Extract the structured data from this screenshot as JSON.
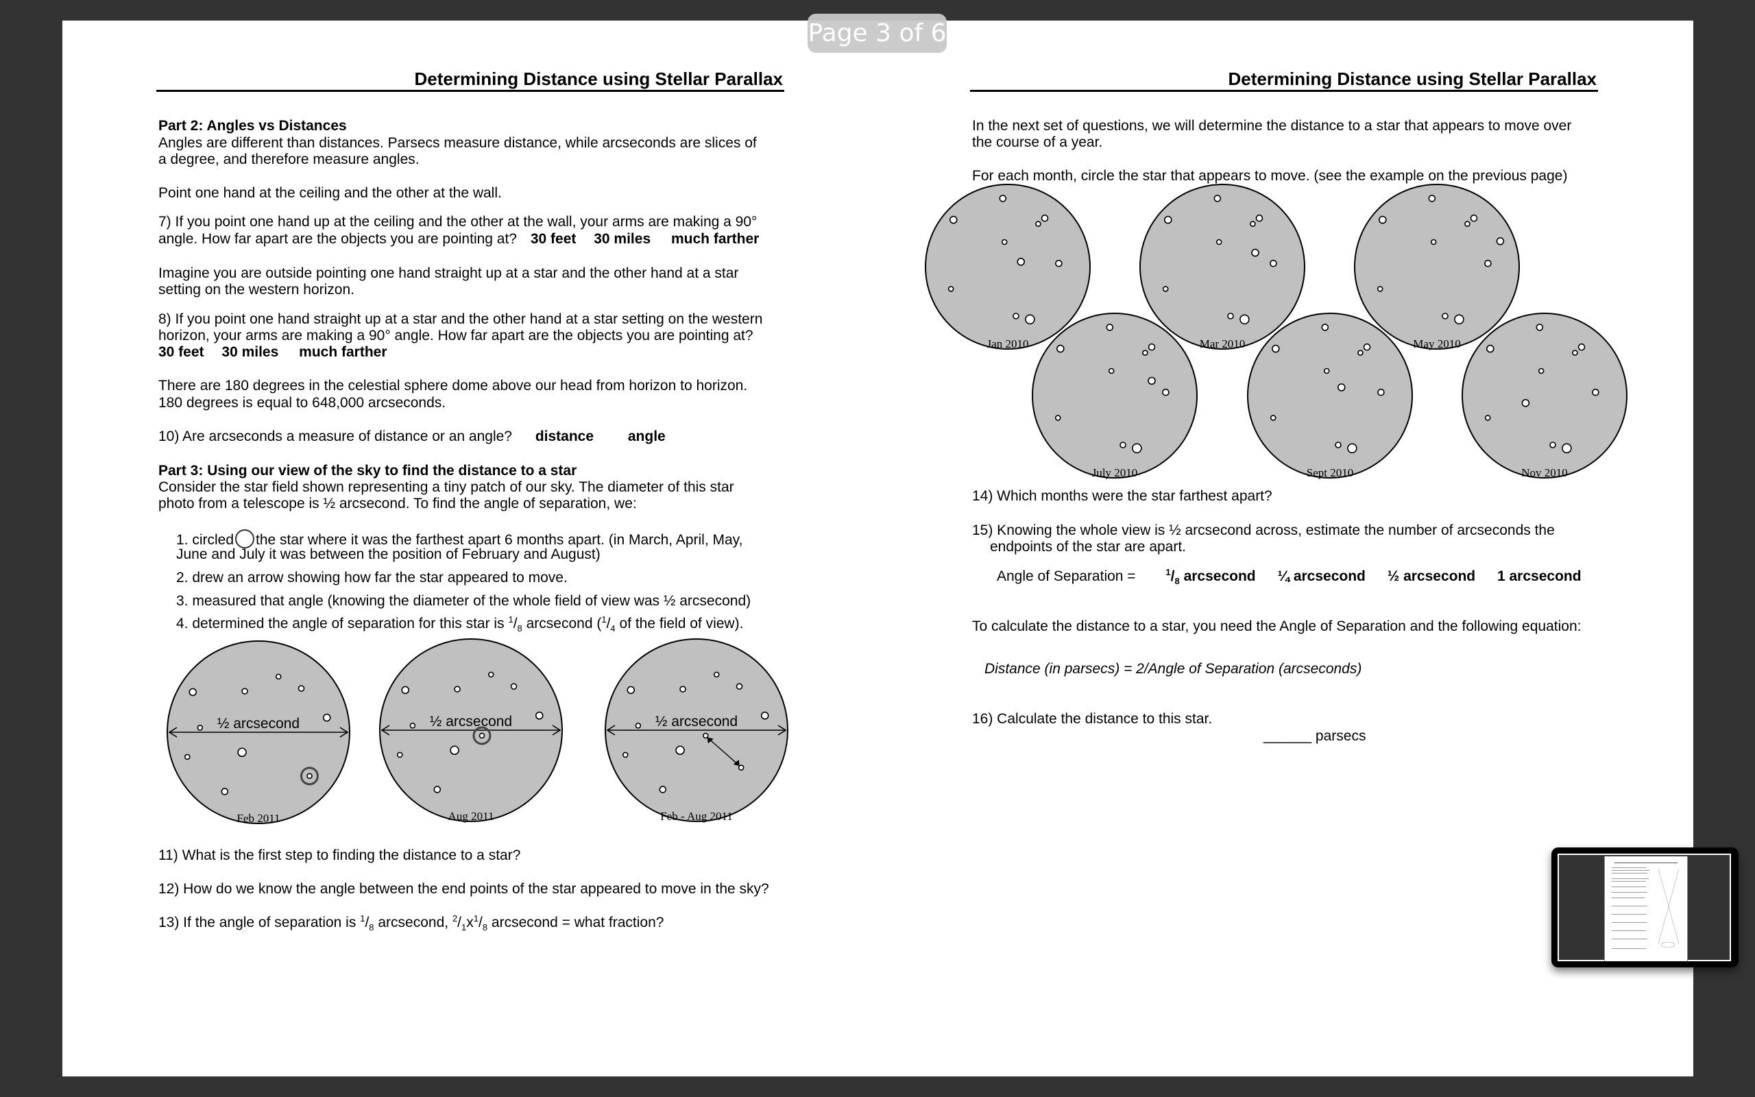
{
  "viewer": {
    "page_indicator": "Page 3 of 6"
  },
  "left_page": {
    "header": "Determining Distance using Stellar Parallax",
    "part2_title": "Part 2: Angles vs Distances",
    "part2_intro_line1": "Angles are different than distances.  Parsecs measure distance, while arcseconds are slices of",
    "part2_intro_line2": "a degree, and therefore measure angles.",
    "point_instruction": "Point one hand at the ceiling and the other at the wall.",
    "q7_line1": "7) If you point one hand up at the ceiling and the other at the wall, your arms are making a 90°",
    "q7_line2": "angle.  How far apart are the objects you are pointing at?",
    "q7_options": [
      "30 feet",
      "30 miles",
      "much farther"
    ],
    "imagine_line1": "Imagine you are outside pointing one hand straight up at a star and the other hand at a star",
    "imagine_line2": "setting on the western horizon.",
    "q8_line1": "8) If you point one hand straight up at a star and the other hand at a star setting on the western",
    "q8_line2": "horizon, your arms are making a 90° angle.  How far apart are the objects you are pointing at?",
    "q8_options": [
      "30 feet",
      "30 miles",
      "much farther"
    ],
    "degrees_line1": "There are 180 degrees in the celestial sphere dome above our head from horizon to horizon.",
    "degrees_line2": "180 degrees is equal to 648,000 arcseconds.",
    "q10_text": "10) Are arcseconds a measure of distance or an angle?",
    "q10_options": [
      "distance",
      "angle"
    ],
    "part3_title": "Part 3: Using our view of the sky to find the distance to a star",
    "part3_intro_line1": "Consider the star field shown representing a tiny patch of our sky.  The diameter of this star",
    "part3_intro_line2": "photo from a telescope is ½ arcsecond.  To find the angle of separation, we:",
    "step1_a": "1. circled",
    "step1_b": "the star where it was the farthest apart 6 months apart.  (in March, April, May,",
    "step1_c": "June and July it was between the position of February and August)",
    "step2": "2. drew an arrow showing how far the star appeared to move.",
    "step3": "3. measured that angle (knowing the diameter of the whole field of view was ½ arcsecond)",
    "step4_a": "4. determined the angle of separation for this star is",
    "step4_frac_num": "1",
    "step4_frac_den": "8",
    "step4_b": "arcsecond (",
    "step4_frac2_num": "1",
    "step4_frac2_den": "4",
    "step4_c": "of the field of view).",
    "example_fields": [
      {
        "label": "Feb 2011",
        "scale_label": "½ arcsecond"
      },
      {
        "label": "Aug 2011",
        "scale_label": "½ arcsecond"
      },
      {
        "label": "Feb - Aug 2011",
        "scale_label": "½ arcsecond"
      }
    ],
    "q11": "11) What is the first step to finding the distance to a star?",
    "q12": "12) How do we know the angle between the end points of the star appeared to move in the sky?",
    "q13_a": "13) If the angle of separation is",
    "q13_frac_num": "1",
    "q13_frac_den": "8",
    "q13_b": "arcsecond,",
    "q13_frac2_num": "2",
    "q13_frac2_den": "1",
    "q13_x": "x",
    "q13_frac3_num": "1",
    "q13_frac3_den": "8",
    "q13_c": "arcsecond = what fraction?"
  },
  "right_page": {
    "header": "Determining Distance using Stellar Parallax",
    "intro_line1": "In the next set of questions, we will determine the distance to a star that appears to move over",
    "intro_line2": "the course of a year.",
    "instruction": "For each month, circle the star that appears to move.  (see the example on the previous page)",
    "month_fields": [
      {
        "label": "Jan 2010"
      },
      {
        "label": "Mar 2010"
      },
      {
        "label": "May 2010"
      },
      {
        "label": "July 2010"
      },
      {
        "label": "Sept 2010"
      },
      {
        "label": "Nov 2010"
      }
    ],
    "q14": "14) Which months were the star farthest apart?",
    "q15_line1": "15) Knowing the whole view is ½ arcsecond across, estimate the number of arcseconds the",
    "q15_line2": "endpoints of the star are apart.",
    "angle_label": "Angle of Separation =",
    "angle_opt1_num": "1",
    "angle_opt1_den": "8",
    "angle_opt1_unit": "arcsecond",
    "angle_options": [
      "¼ arcsecond",
      "½ arcsecond",
      "1 arcsecond"
    ],
    "calc_intro": "To calculate the distance to a star, you need the Angle of Separation and the following equation:",
    "equation": "Distance (in parsecs) = 2/Angle of Separation (arcseconds)",
    "q16": "16) Calculate the distance to this star.",
    "q16_blank": "______",
    "q16_unit": "parsecs"
  },
  "thumbnail": {
    "label": "page-thumbnail"
  }
}
